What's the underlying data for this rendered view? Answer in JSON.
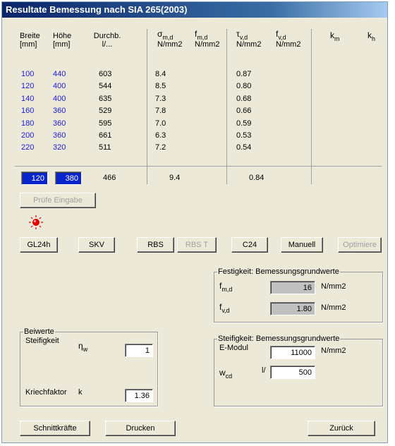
{
  "window": {
    "title": "Resultate Bemessung nach SIA 265(2003)"
  },
  "table": {
    "headers": {
      "breite": [
        "Breite",
        "[mm]"
      ],
      "hoehe": [
        "Höhe",
        "[mm]"
      ],
      "durchb": [
        "Durchb.",
        "l/..."
      ],
      "sigma_md": {
        "symbol": "σ",
        "sub": "m,d",
        "unit": "N/mm2"
      },
      "f_md": {
        "symbol": "f",
        "sub": "m,d",
        "unit": "N/mm2"
      },
      "tau_vd": {
        "symbol": "τ",
        "sub": "v,d",
        "unit": "N/mm2"
      },
      "f_vd": {
        "symbol": "f",
        "sub": "v,d",
        "unit": "N/mm2"
      },
      "k_m": {
        "symbol": "k",
        "sub": "m"
      },
      "k_h": {
        "symbol": "k",
        "sub": "h"
      }
    },
    "rows": [
      {
        "breite": "100",
        "hoehe": "440",
        "durchb": "603",
        "sigma": "8.4",
        "tau": "0.87"
      },
      {
        "breite": "120",
        "hoehe": "400",
        "durchb": "544",
        "sigma": "8.5",
        "tau": "0.80"
      },
      {
        "breite": "140",
        "hoehe": "400",
        "durchb": "635",
        "sigma": "7.3",
        "tau": "0.68"
      },
      {
        "breite": "160",
        "hoehe": "360",
        "durchb": "529",
        "sigma": "7.8",
        "tau": "0.66"
      },
      {
        "breite": "180",
        "hoehe": "360",
        "durchb": "595",
        "sigma": "7.0",
        "tau": "0.59"
      },
      {
        "breite": "200",
        "hoehe": "360",
        "durchb": "661",
        "sigma": "6.3",
        "tau": "0.53"
      },
      {
        "breite": "220",
        "hoehe": "320",
        "durchb": "511",
        "sigma": "7.2",
        "tau": "0.54"
      }
    ],
    "input_row": {
      "breite": "120",
      "hoehe": "380",
      "durchb": "466",
      "sigma": "9.4",
      "tau": "0.84"
    }
  },
  "buttons": {
    "pruefe": "Prüfe Eingabe",
    "gl24h": "GL24h",
    "skv": "SKV",
    "rbs": "RBS",
    "rbst": "RBS T",
    "c24": "C24",
    "manuell": "Manuell",
    "optimiere": "Optimiere",
    "schnittkraefte": "Schnittkräfte",
    "drucken": "Drucken",
    "zurueck": "Zurück"
  },
  "festigkeit": {
    "title": "Festigkeit: Bemessungsgrundwerte",
    "fmd": {
      "symbol": "f",
      "sub": "m,d",
      "value": "16",
      "unit": "N/mm2"
    },
    "fvd": {
      "symbol": "f",
      "sub": "v,d",
      "value": "1.80",
      "unit": "N/mm2"
    }
  },
  "beiwerte": {
    "title": "Beiwerte",
    "steifigkeit": {
      "label": "Steifigkeit",
      "symbol": "η",
      "sub": "w",
      "value": "1"
    },
    "kriechfaktor": {
      "label": "Kriechfaktor",
      "symbol": "k",
      "value": "1.36"
    }
  },
  "steifigkeit": {
    "title": "Steifigkeit: Bemessungsgrundwerte",
    "emodul": {
      "label": "E-Modul",
      "value": "11000",
      "unit": "N/mm2"
    },
    "wcd": {
      "symbol": "w",
      "sub": "cd",
      "prefix": "l/",
      "value": "500"
    }
  },
  "colors": {
    "title_bar": "#0a246a",
    "selected_field": "#0a24cc",
    "row_values": "#1a1adc",
    "led": "#e00000"
  }
}
